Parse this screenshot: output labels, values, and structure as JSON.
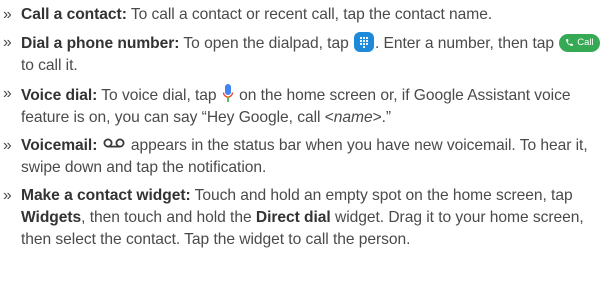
{
  "items": [
    {
      "bullet": "»",
      "term": "Call a contact:",
      "text": " To call a contact or recent call, tap the contact name."
    },
    {
      "bullet": "»",
      "term": "Dial a phone number:",
      "text_before_icon": " To open the dialpad, tap ",
      "text_after_icon": ". Enter a number, then tap ",
      "call_button_label": "Call",
      "text_end": " to call it."
    },
    {
      "bullet": "»",
      "term": "Voice dial:",
      "text_before_icon": " To voice dial, tap ",
      "text_after_icon": " on the home screen or, if Google Assistant voice feature is on, you can say “Hey Google, call <",
      "italic": "name",
      "text_end": ">.”"
    },
    {
      "bullet": "»",
      "term": "Voicemail:",
      "text_after_icon": " appears in the status bar when you have new voicemail. To hear it, swipe down and tap the notification."
    },
    {
      "bullet": "»",
      "term": "Make a contact widget:",
      "text_1": " Touch and hold an empty spot on the home screen, tap ",
      "bold_1": "Widgets",
      "text_2": ", then touch and hold the ",
      "bold_2": "Direct dial",
      "text_3": " widget. Drag it to your home screen, then select the contact. Tap the widget to call the person."
    }
  ],
  "icons": {
    "dialpad": "dialpad-icon",
    "call": "phone-icon",
    "mic": "mic-icon",
    "voicemail": "voicemail-icon"
  },
  "colors": {
    "text": "#4a4a4a",
    "dialpad_blue": "#1c8ad8",
    "call_green": "#36a955",
    "mic_blue": "#4285f4",
    "mic_stem": "#2e7d32"
  }
}
